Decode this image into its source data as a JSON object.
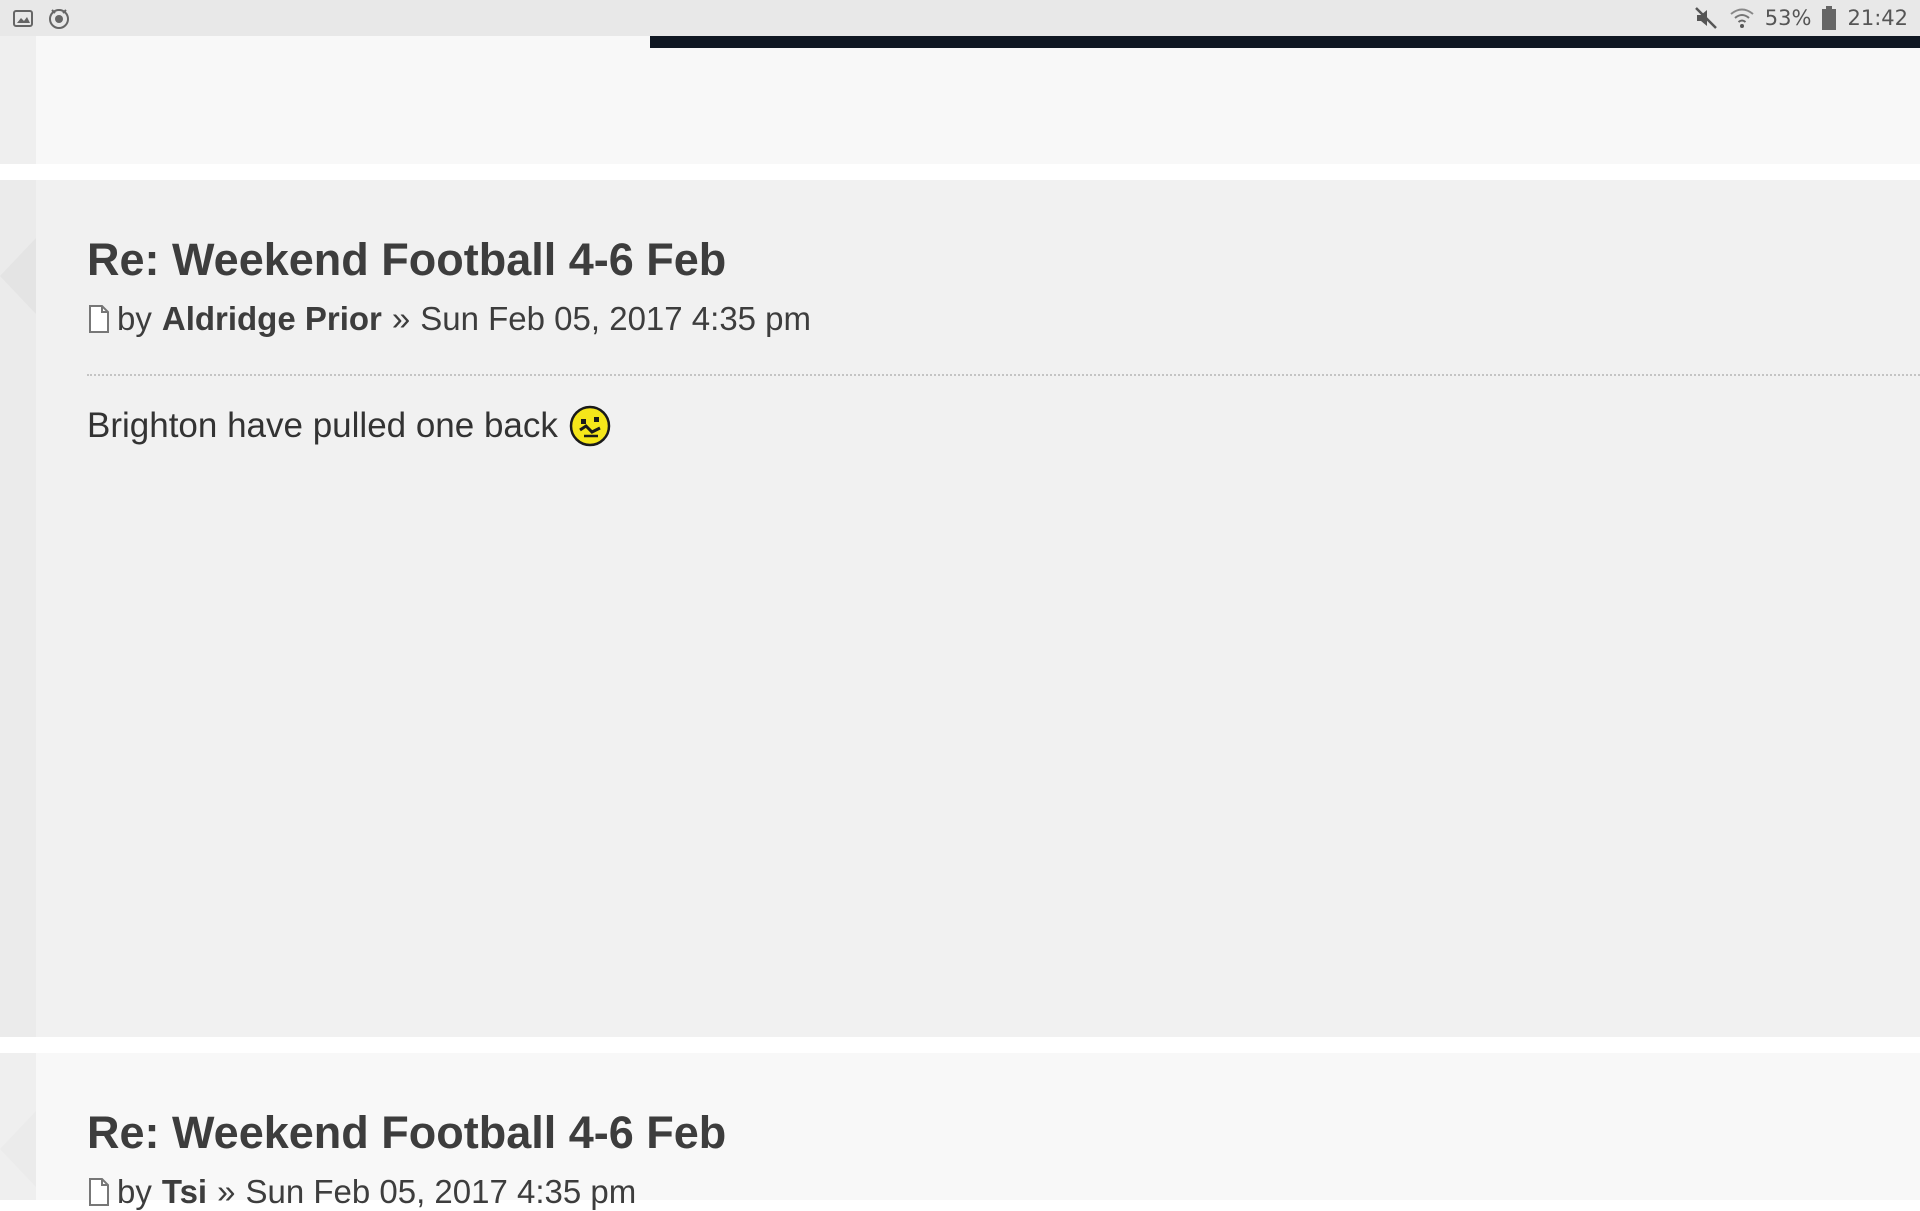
{
  "status_bar": {
    "left_icons": [
      "gallery-icon",
      "recording-icon"
    ],
    "right_icons": [
      "mute-icon",
      "wifi-icon",
      "battery-icon"
    ],
    "battery": "53%",
    "time": "21:42"
  },
  "posts": [
    {
      "title": "Re: Weekend Football 4-6 Feb",
      "by": "by",
      "author": "Aldridge Prior",
      "separator": "»",
      "date": "Sun Feb 05, 2017 4:35 pm",
      "content": "Brighton have pulled one back",
      "emoji": "confused-smiley-icon"
    },
    {
      "title": "Re: Weekend Football 4-6 Feb",
      "by": "by",
      "author": "Tsi",
      "separator": "»",
      "date": "Sun Feb 05, 2017 4:35 pm"
    }
  ],
  "colors": {
    "status_bar_bg": "#e8e8e8",
    "dark_strip": "#0f1722",
    "post_bg_alt": "#f1f1f1",
    "post_bg": "#f8f8f8",
    "title_text": "#3d3d3d"
  }
}
